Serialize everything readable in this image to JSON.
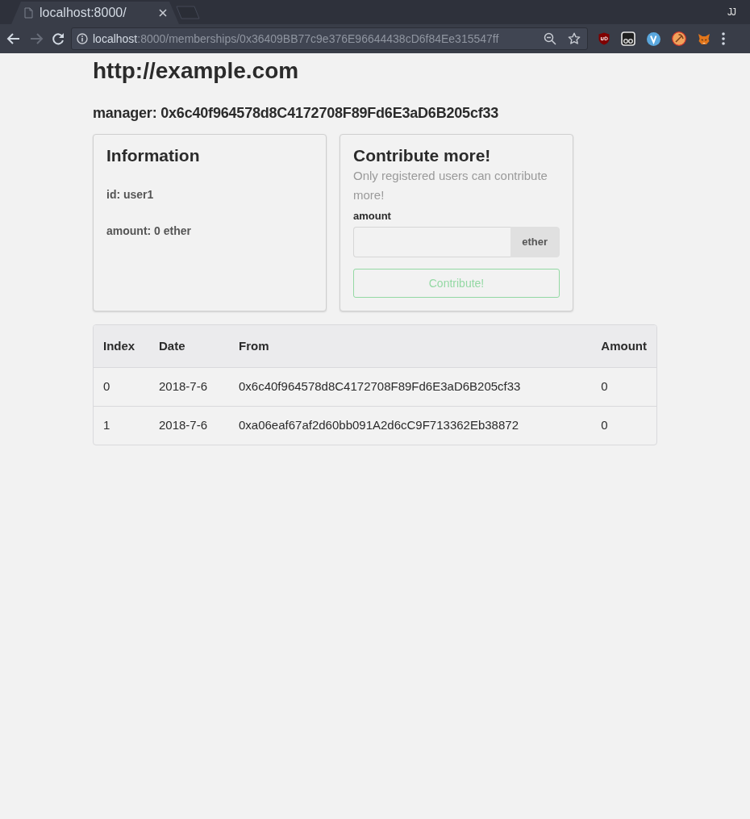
{
  "browser": {
    "tab": {
      "title": "localhost:8000/",
      "selected": true
    },
    "profile": "JJ",
    "nav": {
      "back": {
        "disabled": false
      },
      "forward": {
        "disabled": true
      }
    },
    "address": {
      "host": "localhost",
      "path": ":8000/memberships/0x36409BB77c9e376E96644438cD6f84Ee315547ff"
    }
  },
  "page": {
    "title": "http://example.com",
    "manager": "manager: 0x6c40f964578d8C4172708F89Fd6E3aD6B205cf33"
  },
  "info_card": {
    "title": "Information",
    "lines": [
      "id: user1",
      "amount: 0 ether"
    ]
  },
  "contribute_card": {
    "title": "Contribute more!",
    "note": "Only registered users can contribute more!",
    "field": {
      "label": "amount",
      "unit": "ether"
    },
    "button": {
      "label": "Contribute!",
      "disabled": true
    }
  },
  "table": {
    "columns": [
      "Index",
      "Date",
      "From",
      "Amount"
    ],
    "rows": [
      [
        "0",
        "2018-7-6",
        "0x6c40f964578d8C4172708F89Fd6E3aD6B205cf33",
        "0"
      ],
      [
        "1",
        "2018-7-6",
        "0xa06eaf67af2d60bb091A2d6cC9F713362Eb38872",
        "0"
      ]
    ]
  }
}
